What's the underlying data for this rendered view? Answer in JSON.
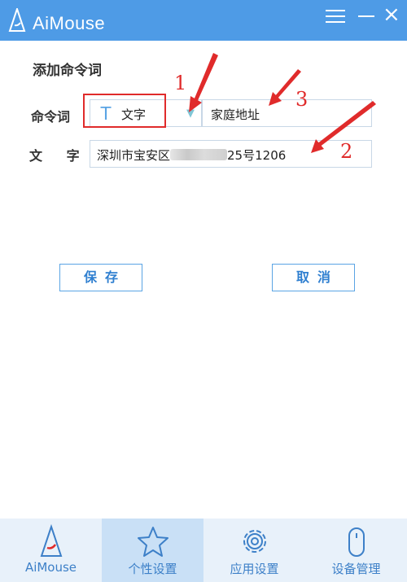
{
  "app": {
    "title": "AiMouse"
  },
  "icons": {
    "logo": "aimouse-logo",
    "menu": "menu-icon",
    "minimize": "minimize-icon",
    "close": "close-icon",
    "caret": "caret-down-icon",
    "type": "text-type-icon"
  },
  "colors": {
    "titlebar": "#4e9be6",
    "accent": "#5aa4e4",
    "annotation": "#e02b2b",
    "nav_bg": "#e8f1fa",
    "nav_active": "#c9e0f6"
  },
  "window": {
    "close_glyph": "×"
  },
  "form": {
    "title": "添加命令词",
    "command_label": "命令词",
    "type_icon_glyph": "T",
    "type_value": "文字",
    "name_value": "家庭地址",
    "text_label": "文 字",
    "text_value_start": "深圳市宝安区",
    "text_value_end": "25号1206"
  },
  "annotations": {
    "one": "1",
    "two": "2",
    "three": "3"
  },
  "buttons": {
    "save": "保存",
    "cancel": "取消"
  },
  "nav": {
    "items": [
      {
        "label": "AiMouse",
        "icon": "aimouse-logo-icon",
        "active": false
      },
      {
        "label": "个性设置",
        "icon": "star-icon",
        "active": true
      },
      {
        "label": "应用设置",
        "icon": "gear-icon",
        "active": false
      },
      {
        "label": "设备管理",
        "icon": "mouse-icon",
        "active": false
      }
    ]
  }
}
